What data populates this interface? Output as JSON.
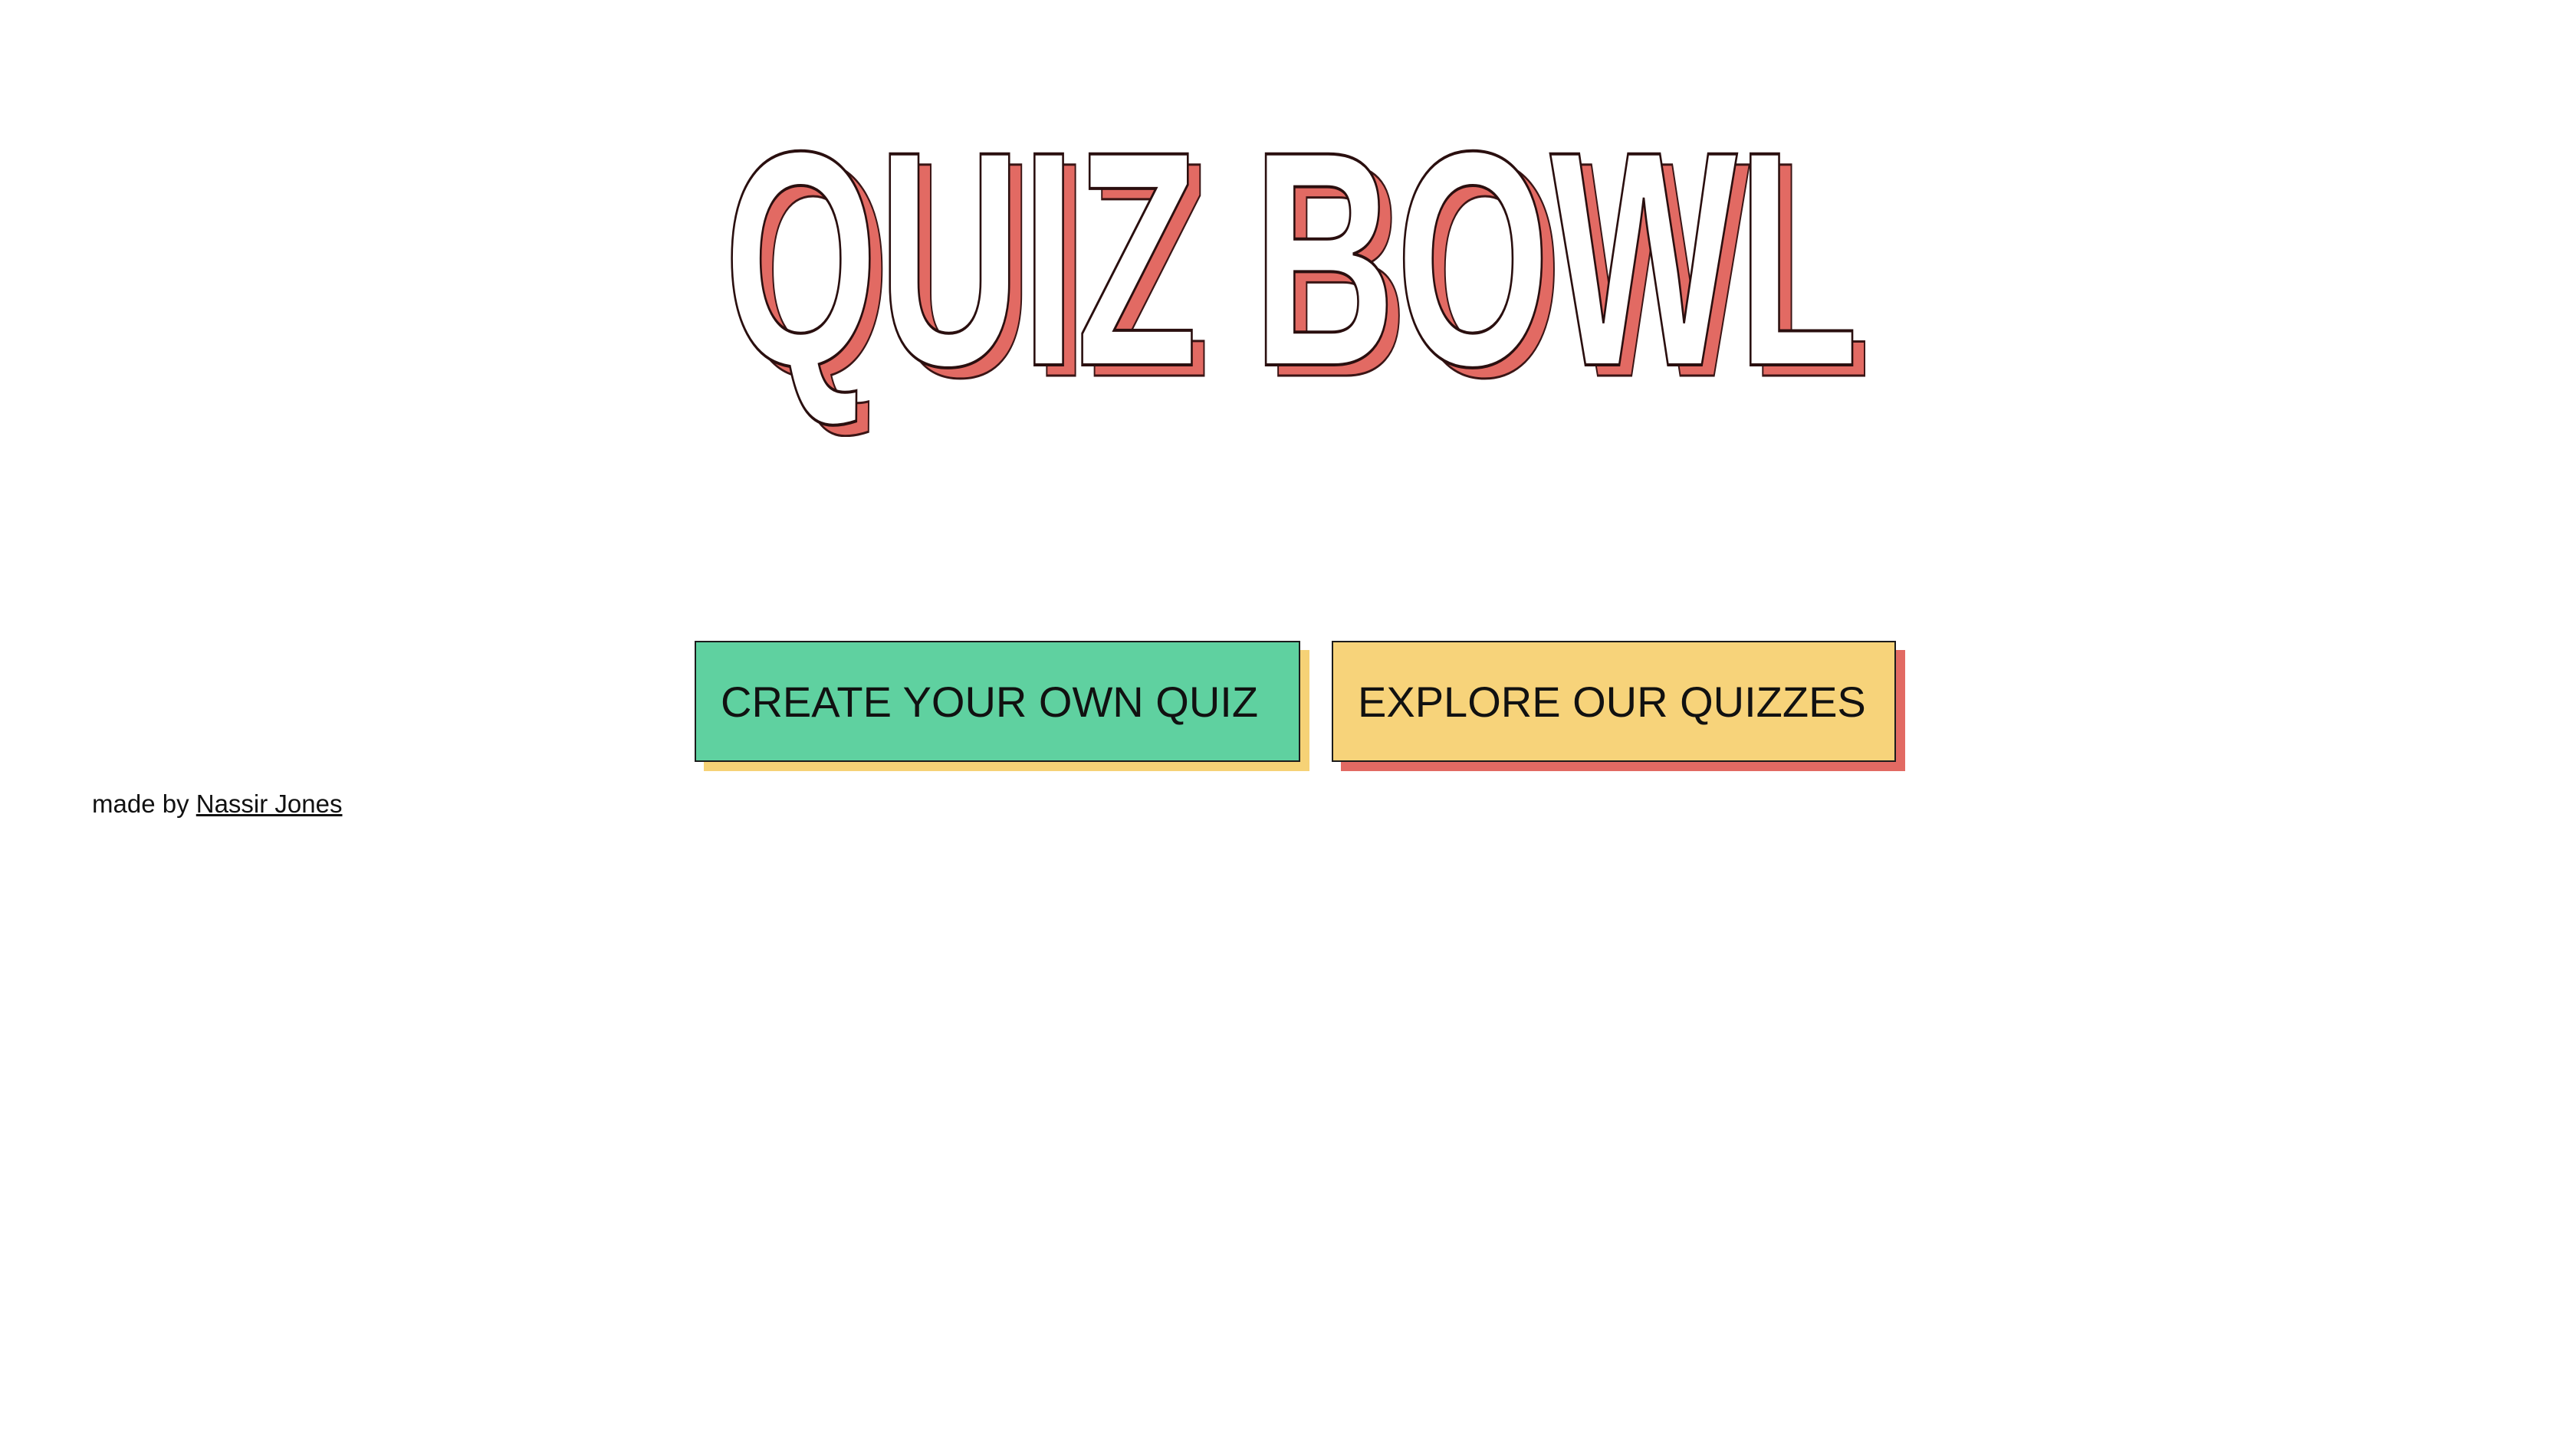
{
  "title": "QUIZ BOWL",
  "buttons": {
    "create_label": "CREATE YOUR OWN QUIZ",
    "explore_label": "EXPLORE OUR QUIZZES"
  },
  "footer": {
    "prefix": "made by",
    "author_link": "Nassir Jones"
  },
  "colors": {
    "title_shadow": "#e26a63",
    "create_button": "#5fd1a0",
    "create_shadow": "#f6d276",
    "explore_button": "#f7d37a",
    "explore_shadow": "#e26a63"
  }
}
